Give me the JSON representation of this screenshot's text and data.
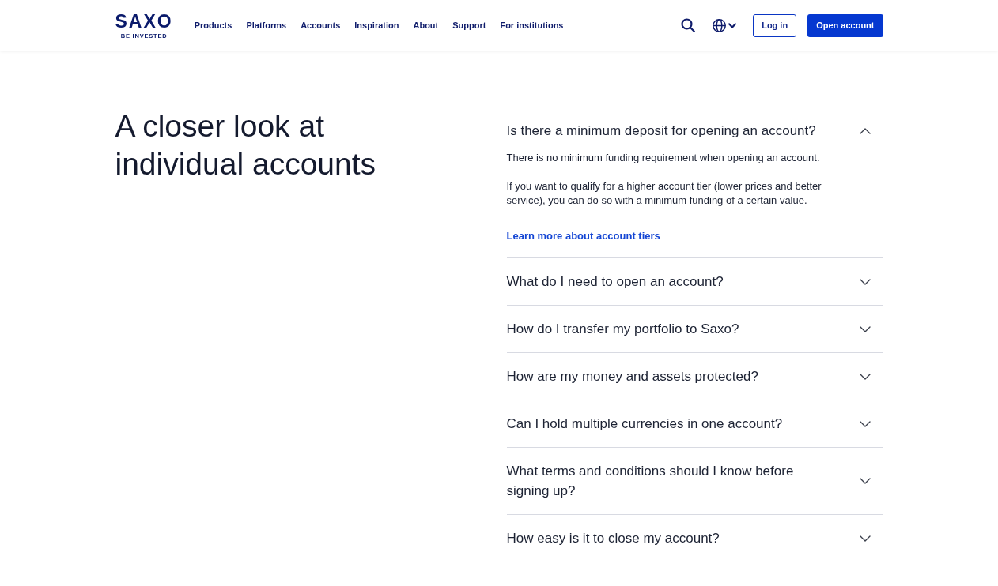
{
  "header": {
    "logo": {
      "wordmark": "SAXO",
      "tagline": "BE INVESTED"
    },
    "nav": [
      "Products",
      "Platforms",
      "Accounts",
      "Inspiration",
      "About",
      "Support",
      "For institutions"
    ],
    "login_button": "Log in",
    "open_account_button": "Open account"
  },
  "section": {
    "title": "A closer look at individual accounts",
    "faq": [
      {
        "question": "Is there a minimum deposit for opening an account?",
        "expanded": true,
        "answer": [
          "There is no minimum funding requirement when opening an account.",
          "If you want to qualify for a higher account tier (lower prices and better service), you can do so with a minimum funding of a certain value."
        ],
        "link": "Learn more about account tiers"
      },
      {
        "question": "What do I need to open an account?",
        "expanded": false
      },
      {
        "question": "How do I transfer my portfolio to Saxo?",
        "expanded": false
      },
      {
        "question": "How are my money and assets protected?",
        "expanded": false
      },
      {
        "question": "Can I hold multiple currencies in one account?",
        "expanded": false
      },
      {
        "question": "What terms and conditions should I know before signing up?",
        "expanded": false
      },
      {
        "question": "How easy is it to close my account?",
        "expanded": false
      }
    ]
  }
}
